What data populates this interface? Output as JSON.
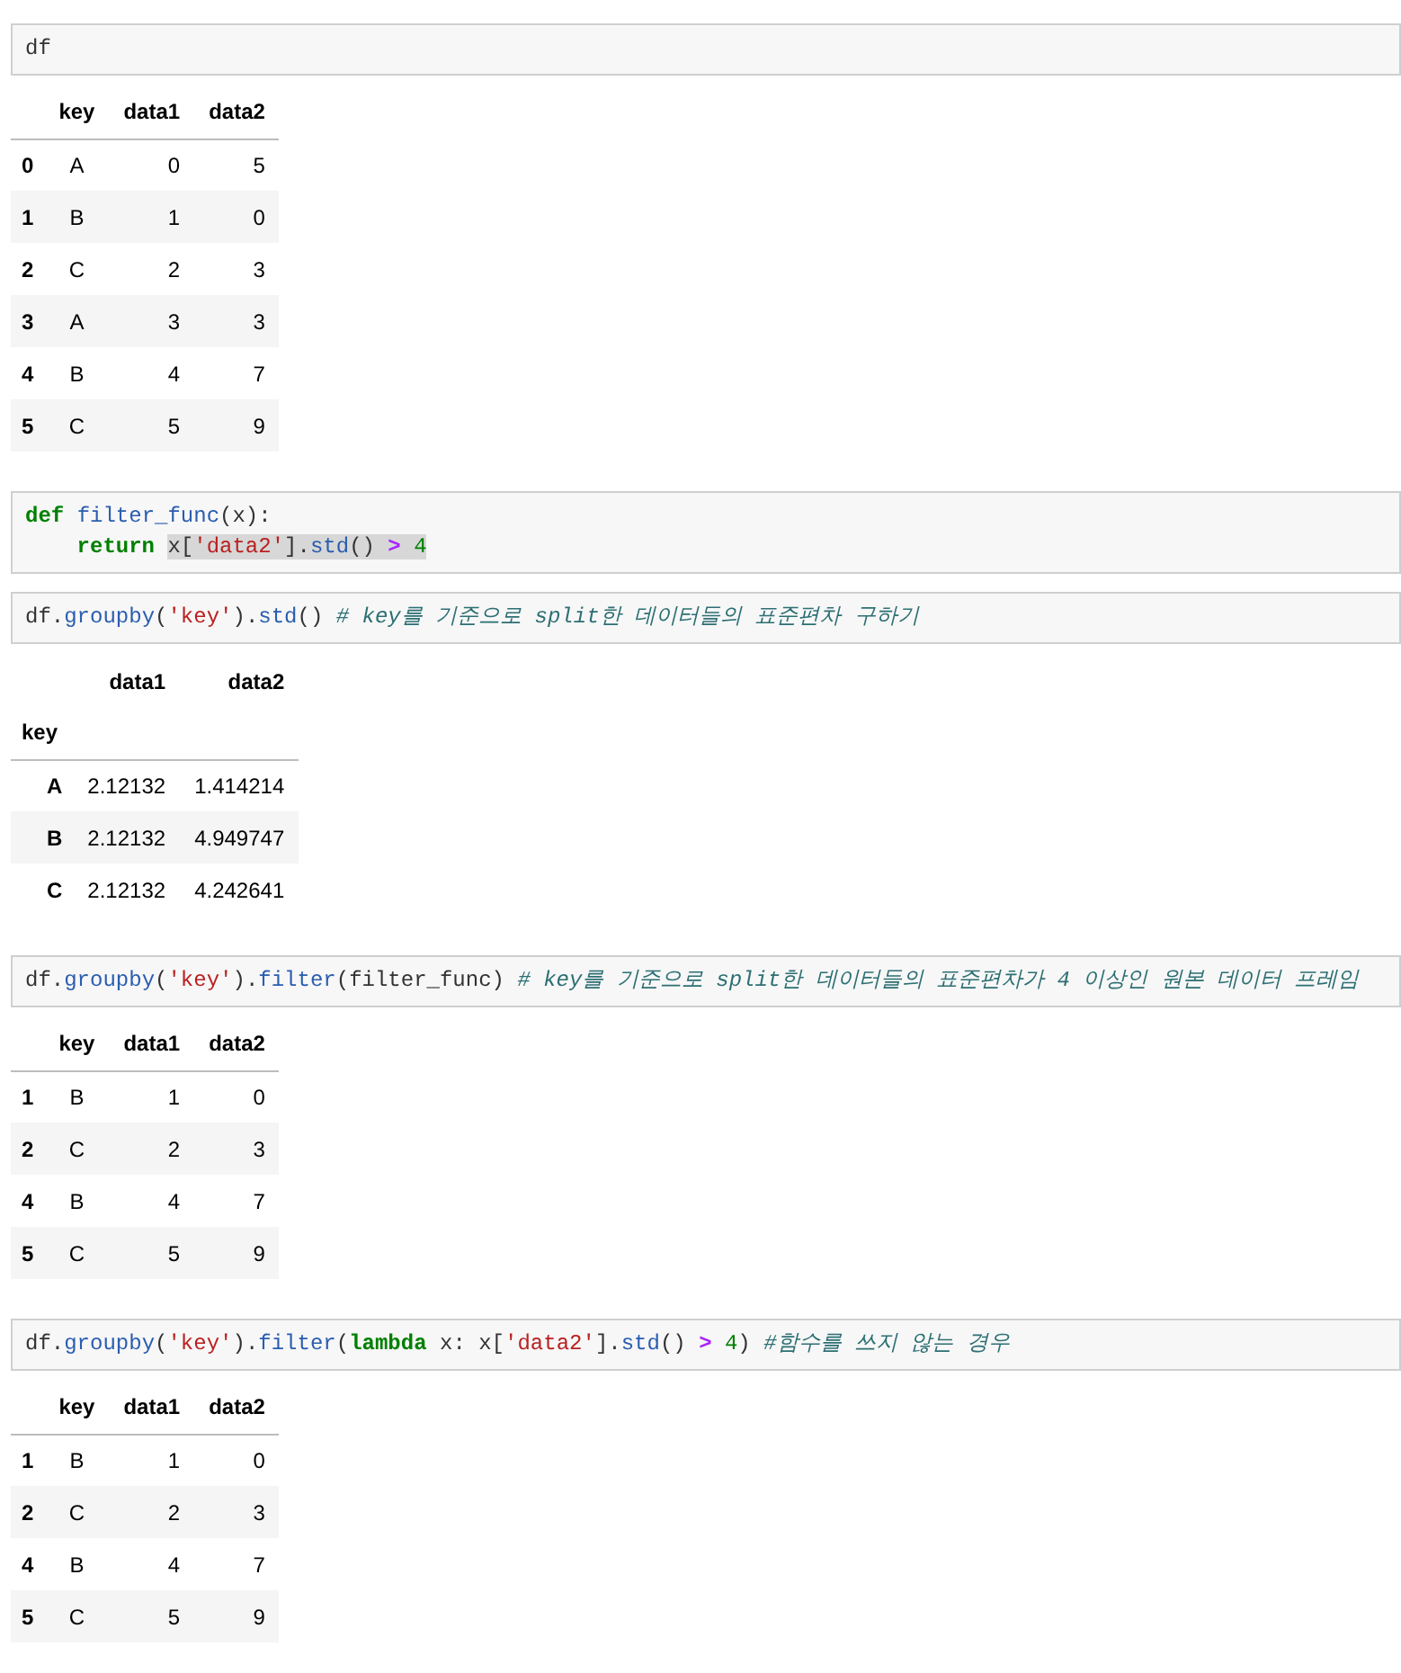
{
  "cells": [
    {
      "input": [
        {
          "tokens": [
            {
              "t": "df",
              "kind": "plain"
            }
          ]
        }
      ],
      "output": {
        "columns": [
          "",
          "key",
          "data1",
          "data2"
        ],
        "rows": [
          {
            "cells": [
              "0",
              "A",
              "0",
              "5"
            ]
          },
          {
            "cells": [
              "1",
              "B",
              "1",
              "0"
            ]
          },
          {
            "cells": [
              "2",
              "C",
              "2",
              "3"
            ]
          },
          {
            "cells": [
              "3",
              "A",
              "3",
              "3"
            ]
          },
          {
            "cells": [
              "4",
              "B",
              "4",
              "7"
            ]
          },
          {
            "cells": [
              "5",
              "C",
              "5",
              "9"
            ]
          }
        ]
      }
    },
    {
      "input": [
        {
          "tokens": [
            {
              "t": "def ",
              "kind": "keyword"
            },
            {
              "t": "filter_func",
              "kind": "function"
            },
            {
              "t": "(x):",
              "kind": "plain"
            }
          ]
        },
        {
          "tokens": [
            {
              "t": "    return ",
              "kind": "keyword"
            }
          ],
          "selection": [
            {
              "t": "x[",
              "kind": "plain"
            },
            {
              "t": "'data2'",
              "kind": "string"
            },
            {
              "t": "].",
              "kind": "plain"
            },
            {
              "t": "std",
              "kind": "function"
            },
            {
              "t": "() ",
              "kind": "plain"
            },
            {
              "t": ">",
              "kind": "operator"
            },
            {
              "t": " 4",
              "kind": "number"
            }
          ]
        }
      ]
    },
    {
      "input": [
        {
          "tokens": [
            {
              "t": "df.",
              "kind": "plain"
            },
            {
              "t": "groupby",
              "kind": "function"
            },
            {
              "t": "(",
              "kind": "plain"
            },
            {
              "t": "'key'",
              "kind": "string"
            },
            {
              "t": ").",
              "kind": "plain"
            },
            {
              "t": "std",
              "kind": "function"
            },
            {
              "t": "() ",
              "kind": "plain"
            },
            {
              "t": "# key를 기준으로 split한 데이터들의 표준편차 구하기",
              "kind": "comment"
            }
          ]
        }
      ],
      "output": {
        "columns": [
          "",
          "data1",
          "data2"
        ],
        "index_name": "key",
        "rows": [
          {
            "cells": [
              "A",
              "2.12132",
              "1.414214"
            ]
          },
          {
            "cells": [
              "B",
              "2.12132",
              "4.949747"
            ]
          },
          {
            "cells": [
              "C",
              "2.12132",
              "4.242641"
            ]
          }
        ]
      }
    },
    {
      "input": [
        {
          "tokens": [
            {
              "t": "df.",
              "kind": "plain"
            },
            {
              "t": "groupby",
              "kind": "function"
            },
            {
              "t": "(",
              "kind": "plain"
            },
            {
              "t": "'key'",
              "kind": "string"
            },
            {
              "t": ").",
              "kind": "plain"
            },
            {
              "t": "filter",
              "kind": "function"
            },
            {
              "t": "(filter_func) ",
              "kind": "plain"
            },
            {
              "t": "# key를 기준으로 split한 데이터들의 표준편차가 4 이상인 원본 데이터 프레임",
              "kind": "comment"
            }
          ]
        }
      ],
      "output": {
        "columns": [
          "",
          "key",
          "data1",
          "data2"
        ],
        "rows": [
          {
            "cells": [
              "1",
              "B",
              "1",
              "0"
            ]
          },
          {
            "cells": [
              "2",
              "C",
              "2",
              "3"
            ]
          },
          {
            "cells": [
              "4",
              "B",
              "4",
              "7"
            ]
          },
          {
            "cells": [
              "5",
              "C",
              "5",
              "9"
            ]
          }
        ]
      }
    },
    {
      "input": [
        {
          "tokens": [
            {
              "t": "df.",
              "kind": "plain"
            },
            {
              "t": "groupby",
              "kind": "function"
            },
            {
              "t": "(",
              "kind": "plain"
            },
            {
              "t": "'key'",
              "kind": "string"
            },
            {
              "t": ").",
              "kind": "plain"
            },
            {
              "t": "filter",
              "kind": "function"
            },
            {
              "t": "(",
              "kind": "plain"
            },
            {
              "t": "lambda",
              "kind": "keyword"
            },
            {
              "t": " x: x[",
              "kind": "plain"
            },
            {
              "t": "'data2'",
              "kind": "string"
            },
            {
              "t": "].",
              "kind": "plain"
            },
            {
              "t": "std",
              "kind": "function"
            },
            {
              "t": "() ",
              "kind": "plain"
            },
            {
              "t": ">",
              "kind": "operator"
            },
            {
              "t": " 4",
              "kind": "number"
            },
            {
              "t": ") ",
              "kind": "plain"
            },
            {
              "t": "#함수를 쓰지 않는 경우",
              "kind": "comment"
            }
          ]
        }
      ],
      "output": {
        "columns": [
          "",
          "key",
          "data1",
          "data2"
        ],
        "rows": [
          {
            "cells": [
              "1",
              "B",
              "1",
              "0"
            ]
          },
          {
            "cells": [
              "2",
              "C",
              "2",
              "3"
            ]
          },
          {
            "cells": [
              "4",
              "B",
              "4",
              "7"
            ]
          },
          {
            "cells": [
              "5",
              "C",
              "5",
              "9"
            ]
          }
        ]
      }
    }
  ]
}
